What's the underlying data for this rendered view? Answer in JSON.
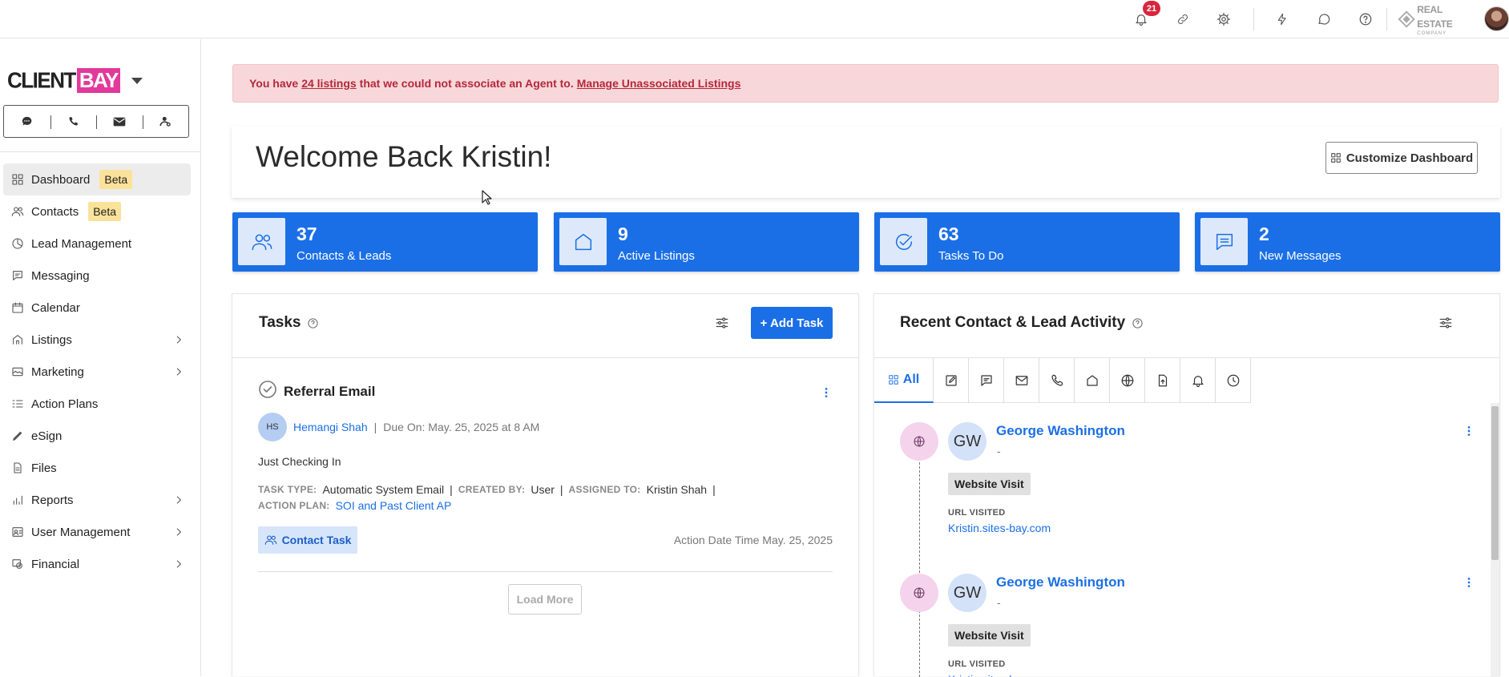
{
  "topbar": {
    "notification_count": "21",
    "brand_name": "REAL ESTATE",
    "brand_sub": "COMPANY"
  },
  "sidebar": {
    "logo_left": "CLIENT",
    "logo_right": "BAY",
    "quick_actions": [
      "chat-icon",
      "phone-icon",
      "mail-icon",
      "add-contact-icon"
    ],
    "items": [
      {
        "label": "Dashboard",
        "badge": "Beta",
        "icon": "dashboard-icon"
      },
      {
        "label": "Contacts",
        "badge": "Beta",
        "icon": "contacts-icon"
      },
      {
        "label": "Lead Management",
        "icon": "lead-icon"
      },
      {
        "label": "Messaging",
        "icon": "messaging-icon"
      },
      {
        "label": "Calendar",
        "icon": "calendar-icon"
      },
      {
        "label": "Listings",
        "icon": "listings-icon",
        "expandable": true
      },
      {
        "label": "Marketing",
        "icon": "marketing-icon",
        "expandable": true
      },
      {
        "label": "Action Plans",
        "icon": "action-plans-icon"
      },
      {
        "label": "eSign",
        "icon": "esign-icon"
      },
      {
        "label": "Files",
        "icon": "files-icon"
      },
      {
        "label": "Reports",
        "icon": "reports-icon",
        "expandable": true
      },
      {
        "label": "User Management",
        "icon": "user-management-icon",
        "expandable": true
      },
      {
        "label": "Financial",
        "icon": "financial-icon",
        "expandable": true
      }
    ]
  },
  "alert": {
    "prefix": "You have",
    "count_link": "24 listings",
    "middle": "that we could not associate an Agent to.",
    "action_link": "Manage Unassociated Listings"
  },
  "welcome": {
    "title": "Welcome Back Kristin!",
    "customize_label": "Customize Dashboard"
  },
  "stats": [
    {
      "value": "37",
      "label": "Contacts & Leads",
      "icon": "contacts-icon"
    },
    {
      "value": "9",
      "label": "Active Listings",
      "icon": "house-icon"
    },
    {
      "value": "63",
      "label": "Tasks To Do",
      "icon": "check-circle-icon"
    },
    {
      "value": "2",
      "label": "New Messages",
      "icon": "message-icon"
    }
  ],
  "tasks": {
    "title": "Tasks",
    "add_label": "+ Add Task",
    "item": {
      "title": "Referral Email",
      "initials": "HS",
      "person": "Hemangi Shah",
      "due": "Due On: May. 25, 2025 at 8 AM",
      "description": "Just Checking In",
      "task_type_key": "TASK TYPE:",
      "task_type": "Automatic System Email",
      "created_by_key": "CREATED BY:",
      "created_by": "User",
      "assigned_to_key": "ASSIGNED TO:",
      "assigned_to": "Kristin Shah",
      "action_plan_key": "ACTION PLAN:",
      "action_plan": "SOI and Past Client AP",
      "tag": "Contact Task",
      "action_date": "Action Date Time May. 25, 2025"
    },
    "load_more": "Load More"
  },
  "activity": {
    "title": "Recent Contact & Lead Activity",
    "tab_all": "All",
    "tabs": [
      "edit-icon",
      "chat-icon",
      "mail-icon",
      "phone-icon",
      "house-icon",
      "globe-icon",
      "upload-file-icon",
      "bell-icon",
      "clock-icon"
    ],
    "entries": [
      {
        "initials": "GW",
        "name": "George Washington",
        "sub": "-",
        "badge": "Website Visit",
        "key": "URL VISITED",
        "url": "Kristin.sites-bay.com"
      },
      {
        "initials": "GW",
        "name": "George Washington",
        "sub": "-",
        "badge": "Website Visit",
        "key": "URL VISITED",
        "url": "Kristin.sites-bay.com"
      }
    ]
  }
}
